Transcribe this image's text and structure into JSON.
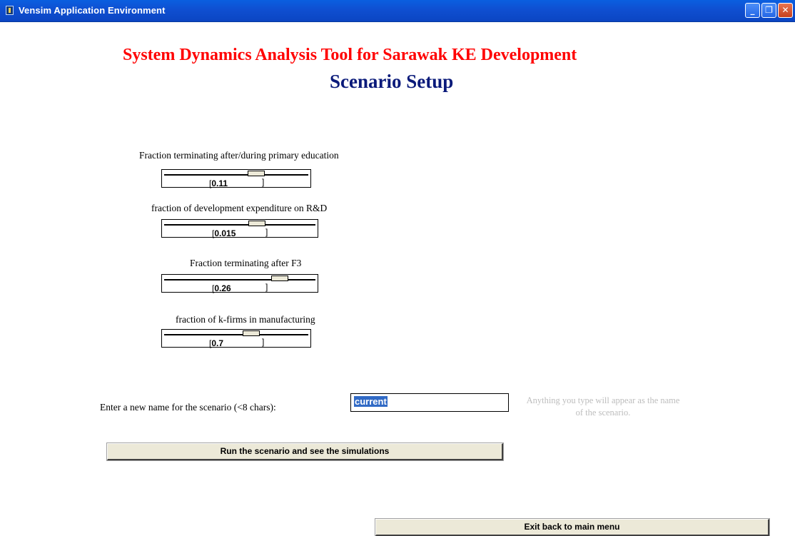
{
  "window": {
    "title": "Vensim Application Environment",
    "icon": "vensim-app-icon",
    "controls": [
      "minimize-icon",
      "restore-icon",
      "close-icon"
    ]
  },
  "header": {
    "title": "System Dynamics Analysis Tool for Sarawak KE Development",
    "subtitle": "Scenario Setup"
  },
  "sliders": [
    {
      "label": "Fraction terminating after/during primary education",
      "value": "0.11",
      "position": 0.66
    },
    {
      "label": "fraction of development expenditure on R&D",
      "value": "0.015",
      "position": 0.63
    },
    {
      "label": "Fraction terminating after F3",
      "value": "0.26",
      "position": 0.8
    },
    {
      "label": "fraction of k-firms in manufacturing",
      "value": "0.7",
      "position": 0.62
    }
  ],
  "scenario": {
    "prompt": "Enter a new name for the scenario (<8 chars):",
    "name_value": "current",
    "hint": "Anything you type will appear as the name of the scenario."
  },
  "buttons": {
    "run": "Run the scenario and see the simulations",
    "exit": "Exit back to main menu"
  },
  "colors": {
    "heading_title": "#ff0000",
    "heading_subtitle": "#0a1a7a",
    "titlebar": "#0f4fd1",
    "selection": "#316ac5",
    "hint_text": "#bdbdbd"
  }
}
